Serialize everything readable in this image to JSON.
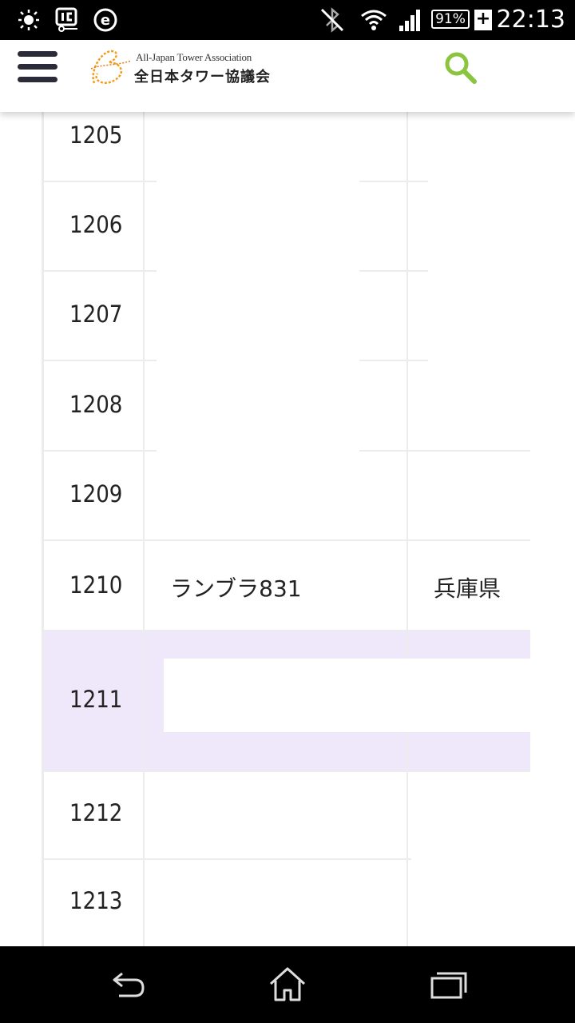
{
  "status_bar": {
    "time": "22:13",
    "battery_percent": "91%",
    "battery_charging_symbol": "+",
    "icons": [
      "brightness-icon",
      "ic-card-icon",
      "e-app-icon",
      "bluetooth-off-icon",
      "wifi-icon",
      "signal-icon",
      "battery-icon"
    ]
  },
  "header": {
    "logo_en": "All-Japan Tower Association",
    "logo_jp": "全日本タワー協議会",
    "accent_color": "#8bc53f"
  },
  "table": {
    "rows": [
      {
        "number": "1205",
        "name": "",
        "prefecture": ""
      },
      {
        "number": "1206",
        "name": "",
        "prefecture": ""
      },
      {
        "number": "1207",
        "name": "",
        "prefecture": ""
      },
      {
        "number": "1208",
        "name": "",
        "prefecture": ""
      },
      {
        "number": "1209",
        "name": "",
        "prefecture": ""
      },
      {
        "number": "1210",
        "name": "ランブラ831",
        "prefecture": "兵庫県"
      },
      {
        "number": "1211",
        "name": "",
        "prefecture": ""
      },
      {
        "number": "1212",
        "name": "",
        "prefecture": ""
      },
      {
        "number": "1213",
        "name": "",
        "prefecture": ""
      }
    ],
    "highlight_color": "#efe8fb"
  },
  "nav_bar": {
    "icons": [
      "back-icon",
      "home-icon",
      "recent-apps-icon"
    ]
  }
}
